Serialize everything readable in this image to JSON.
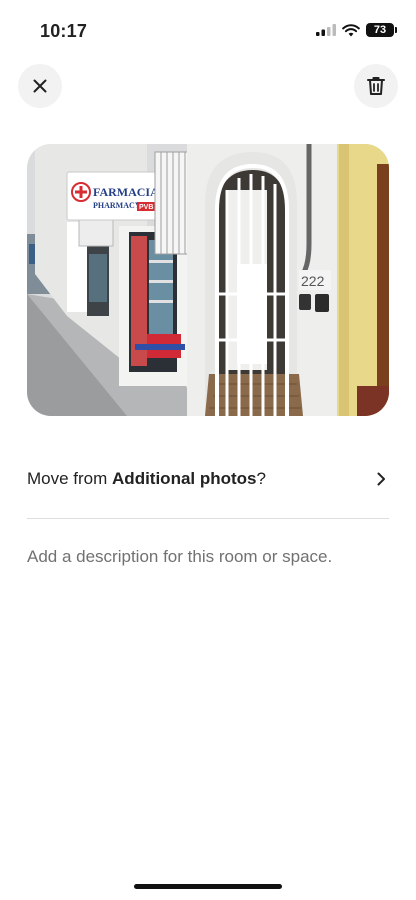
{
  "status_bar": {
    "time": "10:17",
    "battery": "73"
  },
  "icons": {
    "close": "close-icon",
    "delete": "trash-icon",
    "chevron": "chevron-right-icon"
  },
  "photo": {
    "sign_line1": "FARMACIA",
    "sign_line2": "PHARMACY",
    "sign_badge": "PVB",
    "house_number": "222"
  },
  "move_row": {
    "prefix": "Move from ",
    "bold": "Additional photos",
    "suffix": "?"
  },
  "description": {
    "placeholder": "Add a description for this room or space."
  }
}
